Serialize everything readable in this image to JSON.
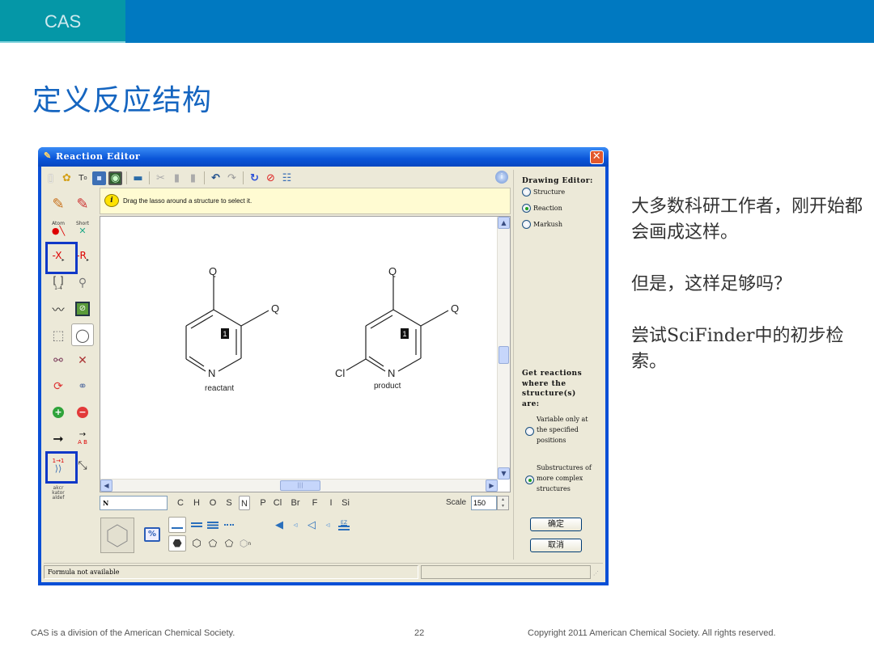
{
  "header": {
    "brand": "CAS"
  },
  "slide": {
    "title": "定义反应结构",
    "side_text": [
      "大多数科研工作者，刚开始都会画成这样。",
      "但是，这样足够吗？",
      "尝试SciFinder中的初步检索。"
    ]
  },
  "footer": {
    "left": "CAS is a division of the American Chemical Society.",
    "page": "22",
    "right": "Copyright 2011 American Chemical Society. All rights reserved."
  },
  "window": {
    "title": "Reaction Editor",
    "close_label": "✕",
    "toolbar": [
      {
        "name": "new-icon",
        "glyph": "🗋"
      },
      {
        "name": "import-icon",
        "glyph": "✦"
      },
      {
        "name": "text-tool-icon",
        "glyph": "T"
      },
      {
        "name": "save-icon",
        "glyph": "▣"
      },
      {
        "name": "template-icon",
        "glyph": "◙"
      },
      {
        "name": "print-icon",
        "glyph": "▬"
      },
      {
        "name": "cut-icon",
        "glyph": "✂"
      },
      {
        "name": "copy-icon",
        "glyph": "▮"
      },
      {
        "name": "paste-icon",
        "glyph": "▮"
      },
      {
        "name": "undo-icon",
        "glyph": "↶"
      },
      {
        "name": "redo-icon",
        "glyph": "↷"
      },
      {
        "name": "refresh-icon",
        "glyph": "↻"
      },
      {
        "name": "clear-icon",
        "glyph": "⊘"
      },
      {
        "name": "notes-icon",
        "glyph": "☰"
      }
    ],
    "hint": "Drag the lasso around a structure to select it.",
    "palette": {
      "atom_label": "Atom",
      "short_label": "Short",
      "x_label": "-X",
      "r_label": "-R",
      "repeat_label": "1-4",
      "ab_label": "A B",
      "chain_label": "akcr kator aldef"
    },
    "canvas": {
      "reactant_label": "reactant",
      "product_label": "product",
      "atoms": {
        "q": "Q",
        "n": "N",
        "cl": "Cl",
        "map": "1"
      }
    },
    "atom_input": "N",
    "elements": [
      "C",
      "H",
      "O",
      "S",
      "N",
      "P",
      "Cl",
      "Br",
      "F",
      "I",
      "Si"
    ],
    "selected_element": "N",
    "scale_label": "Scale",
    "scale_value": "150",
    "bond_ez_label": "EZ",
    "ring_n_label": "n",
    "right_panel": {
      "drawing_editor_label": "Drawing Editor:",
      "modes": [
        {
          "label": "Structure",
          "selected": false
        },
        {
          "label": "Reaction",
          "selected": true
        },
        {
          "label": "Markush",
          "selected": false
        }
      ],
      "get_reactions_label": "Get reactions where the structure(s) are:",
      "options": [
        {
          "label": "Variable only at the specified positions",
          "selected": false
        },
        {
          "label": "Substructures of more complex structures",
          "selected": true
        }
      ],
      "ok_label": "确定",
      "cancel_label": "取消"
    },
    "status": "Formula not available"
  }
}
